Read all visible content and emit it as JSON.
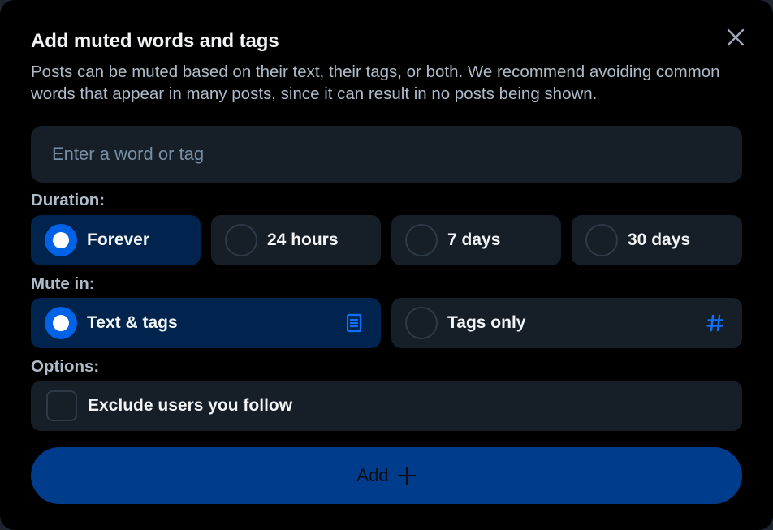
{
  "dialog": {
    "title": "Add muted words and tags",
    "description": "Posts can be muted based on their text, their tags, or both. We recommend avoiding common words that appear in many posts, since it can result in no posts being shown.",
    "close_icon": "close-icon"
  },
  "input": {
    "placeholder": "Enter a word or tag",
    "value": ""
  },
  "duration": {
    "label": "Duration:",
    "options": [
      {
        "label": "Forever",
        "selected": true
      },
      {
        "label": "24 hours",
        "selected": false
      },
      {
        "label": "7 days",
        "selected": false
      },
      {
        "label": "30 days",
        "selected": false
      }
    ]
  },
  "mute_in": {
    "label": "Mute in:",
    "options": [
      {
        "label": "Text & tags",
        "selected": true,
        "icon": "document-text-icon"
      },
      {
        "label": "Tags only",
        "selected": false,
        "icon": "hashtag-icon"
      }
    ]
  },
  "options": {
    "label": "Options:",
    "exclude_following": {
      "label": "Exclude users you follow",
      "checked": false
    }
  },
  "add_button": {
    "label": "Add",
    "icon": "plus-icon"
  },
  "colors": {
    "background": "#000000",
    "surface": "#161e27",
    "selected_surface": "#00244d",
    "accent": "#0062e6",
    "button": "#003c8c",
    "text": "#f1f3f5",
    "muted_text": "#aebbc9"
  }
}
